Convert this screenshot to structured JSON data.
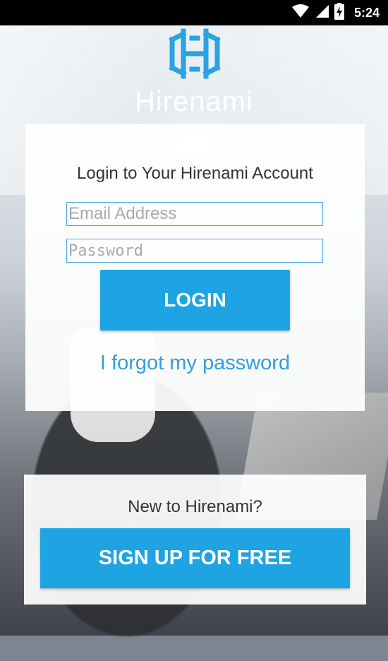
{
  "status_bar": {
    "time": "5:24",
    "icons": [
      "wifi-icon",
      "signal-icon",
      "battery-icon"
    ]
  },
  "brand": {
    "name": "Hirenami",
    "logo_icon": "hirenami-logo-icon"
  },
  "login": {
    "heading": "Login to Your Hirenami Account",
    "email_placeholder": "Email Address",
    "password_placeholder": "Password",
    "login_button": "LOGIN",
    "forgot_link": "I forgot my password"
  },
  "signup": {
    "prompt": "New to Hirenami?",
    "signup_button": "SIGN UP FOR FREE"
  },
  "colors": {
    "accent": "#1ea3e3",
    "link": "#2f9fe0",
    "logo": "#29a3e2"
  }
}
